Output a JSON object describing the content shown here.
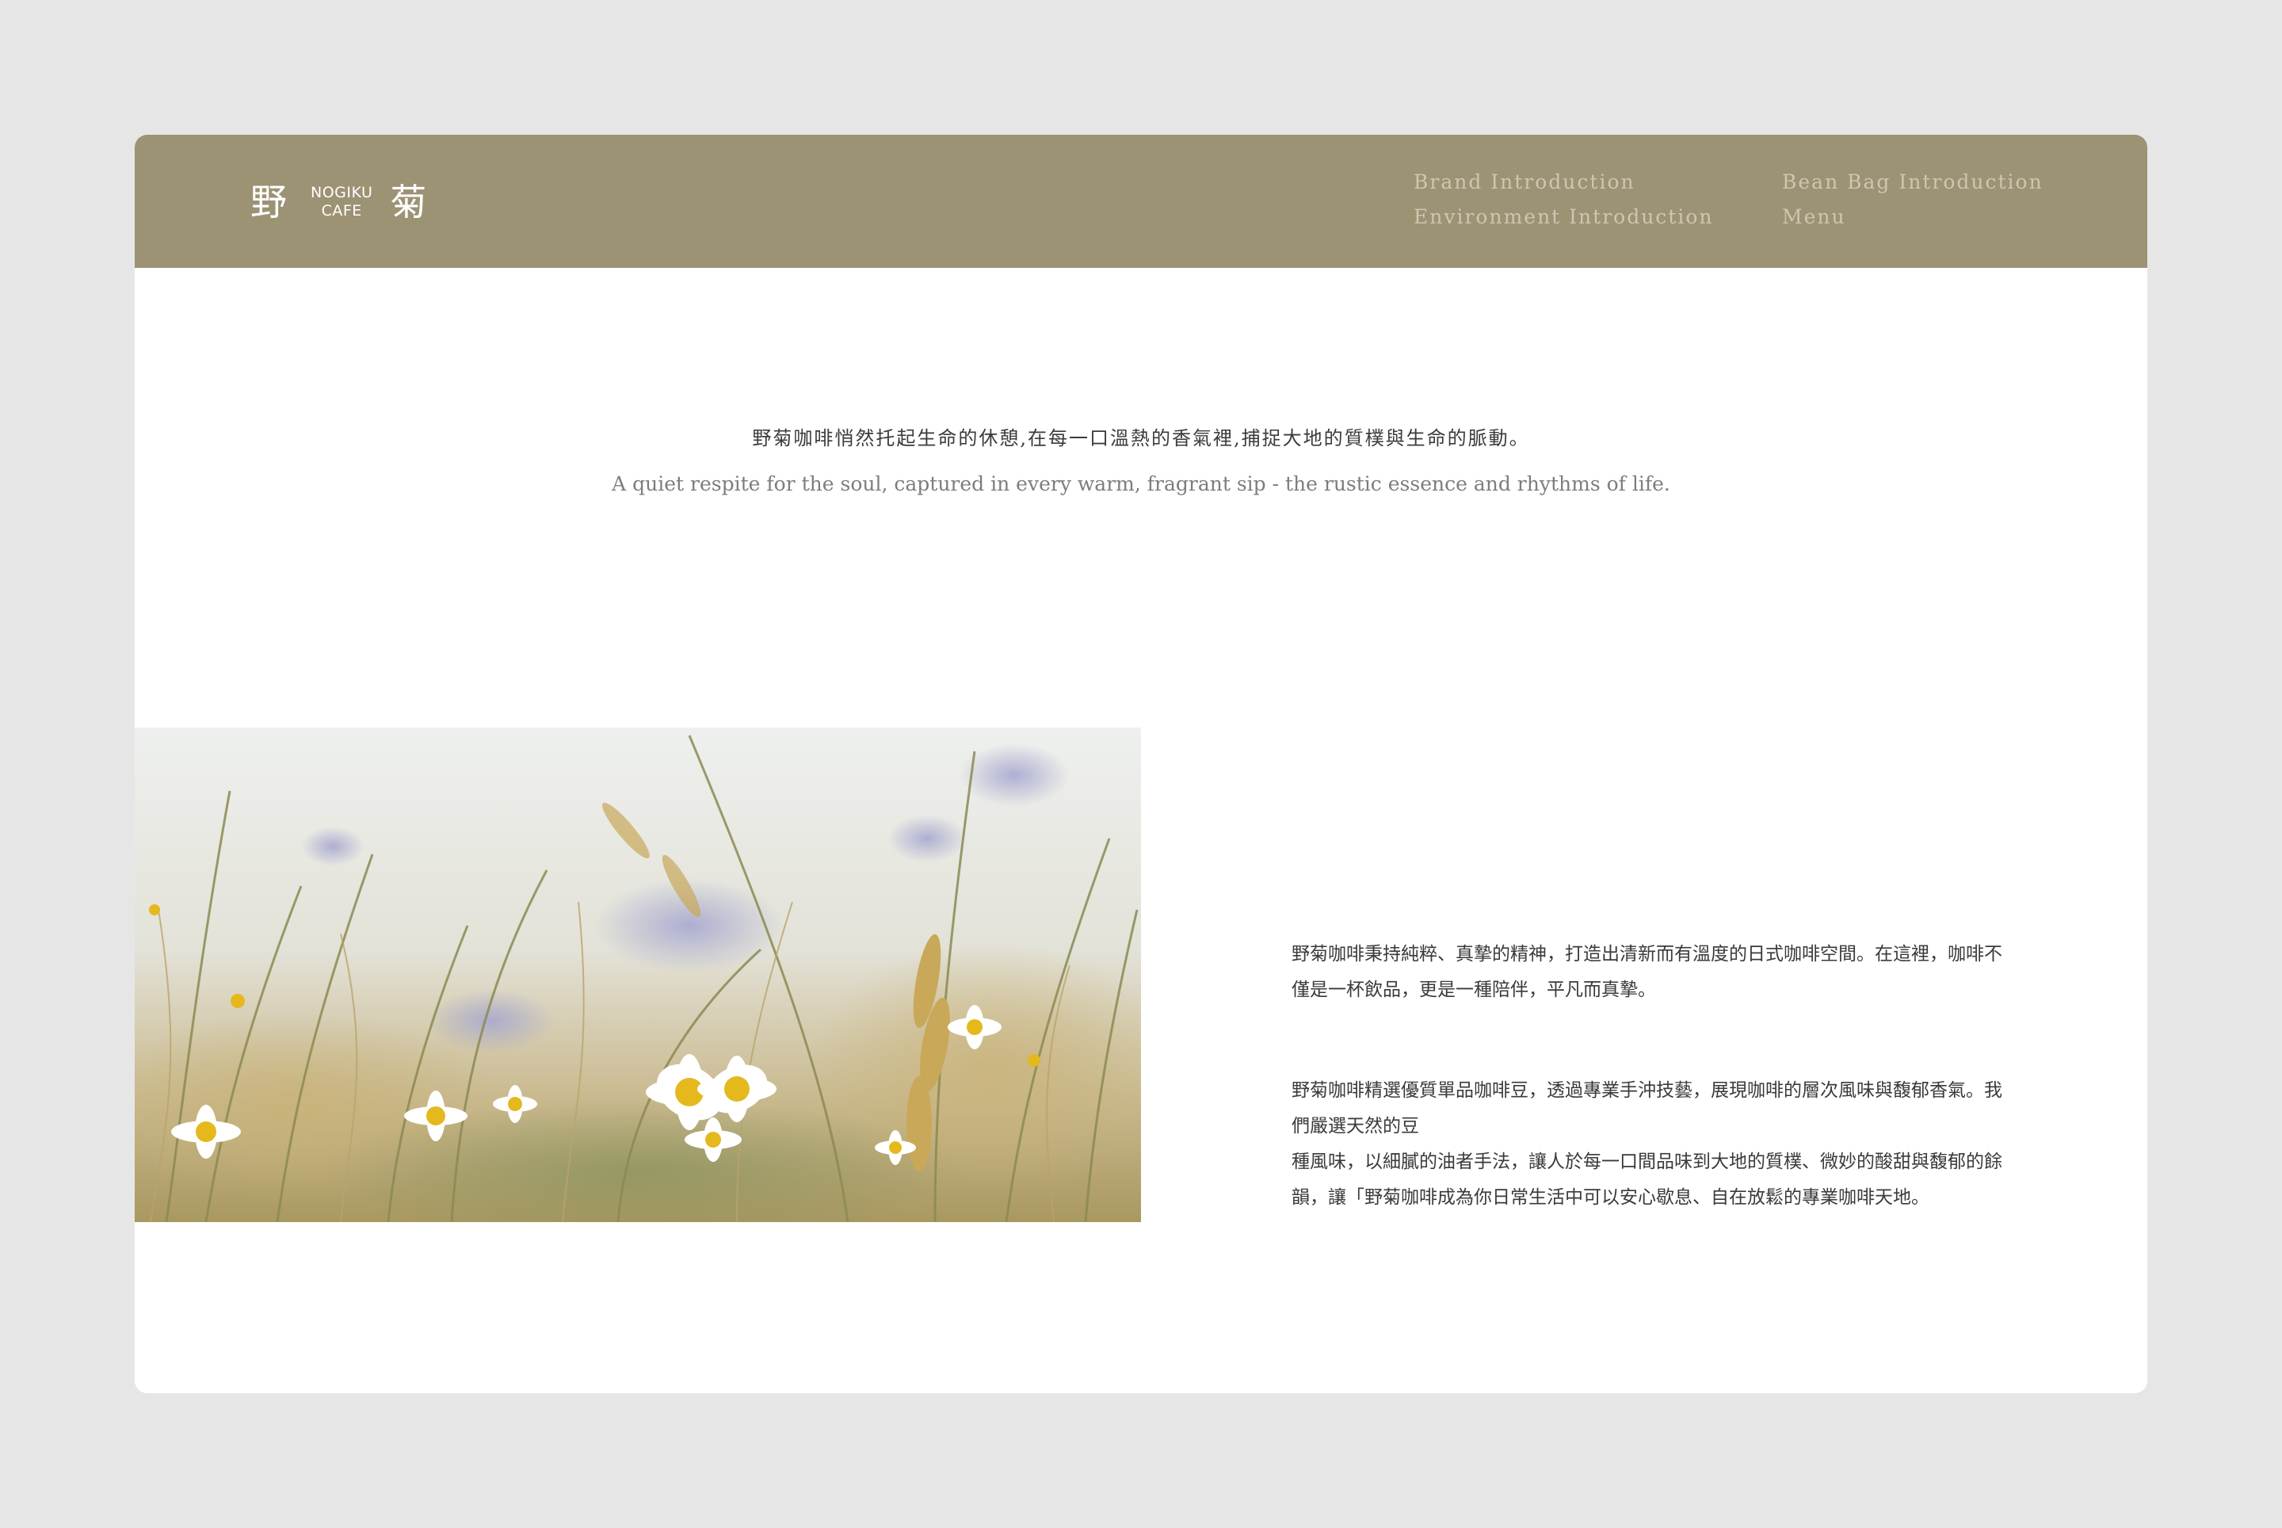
{
  "brand": {
    "char_left": "野",
    "char_right": "菊",
    "sub_line1": "NOGIKU",
    "sub_line2": "CAFE"
  },
  "nav": {
    "items": [
      {
        "label": "Brand Introduction"
      },
      {
        "label": "Bean Bag Introduction"
      },
      {
        "label": "Environment Introduction"
      },
      {
        "label": "Menu"
      }
    ]
  },
  "hero": {
    "tagline_zh": "野菊咖啡悄然托起生命的休憩,在每一口溫熱的香氣裡,捕捉大地的質樸與生命的脈動。",
    "tagline_en": "A quiet respite for the soul, captured in every warm, fragrant sip - the rustic essence and rhythms of life."
  },
  "content": {
    "paragraph1": "野菊咖啡秉持純粹、真摯的精神，打造出清新而有溫度的日式咖啡空間。在這裡，咖啡不僅是一杯飲品，更是一種陪伴，平凡而真摯。",
    "paragraph2_line1": "野菊咖啡精選優質單品咖啡豆，透過專業手沖技藝，展現咖啡的層次風味與馥郁香氣。我們嚴選天然的豆",
    "paragraph2_line2": "種風味，以細膩的油者手法，讓人於每一口間品味到大地的質樸、微妙的酸甜與馥郁的餘韻，讓「野菊咖啡成為你日常生活中可以安心歇息、自在放鬆的專業咖啡天地。"
  },
  "colors": {
    "page_bg": "#e6e6e6",
    "header_bg": "#9c9274",
    "nav_text": "#cdc7b1",
    "body_text": "#3a3a3a"
  }
}
